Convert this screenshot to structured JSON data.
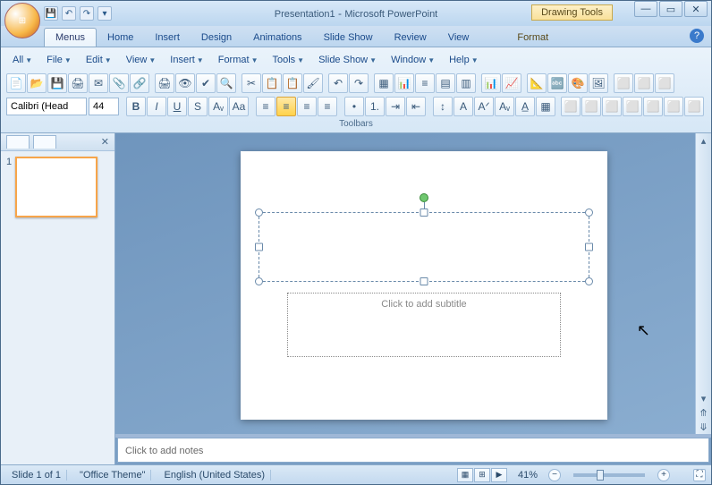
{
  "title": {
    "doc": "Presentation1",
    "app": "Microsoft PowerPoint",
    "contextual": "Drawing Tools"
  },
  "qat": [
    "💾",
    "↶",
    "↷"
  ],
  "tabs": [
    "Menus",
    "Home",
    "Insert",
    "Design",
    "Animations",
    "Slide Show",
    "Review",
    "View"
  ],
  "tabs_active": 0,
  "format_tab": "Format",
  "classic_menus": [
    "All",
    "File",
    "Edit",
    "View",
    "Insert",
    "Format",
    "Tools",
    "Slide Show",
    "Window",
    "Help"
  ],
  "ribbon_label": "Toolbars",
  "font": {
    "name": "Calibri (Head",
    "size": "44"
  },
  "thumb": {
    "num": "1"
  },
  "slide": {
    "subtitle_placeholder": "Click to add subtitle"
  },
  "notes_placeholder": "Click to add notes",
  "status": {
    "slide": "Slide 1 of 1",
    "theme": "\"Office Theme\"",
    "lang": "English (United States)",
    "zoom": "41%"
  },
  "iconrow1": [
    "📄",
    "📂",
    "💾",
    "🖨",
    "✉",
    "📎",
    "🔗",
    "|",
    "🖨",
    "👁",
    "✔",
    "🔍",
    "|",
    "✂",
    "📋",
    "📋",
    "🖌",
    "|",
    "↶",
    "↷",
    "|",
    "▦",
    "📊",
    "≡",
    "▤",
    "▥",
    "|",
    "📊",
    "📈",
    "|",
    "📐",
    "🔤",
    "🎨",
    "🖼",
    "|",
    "⬜",
    "⬜",
    "⬜"
  ],
  "iconrow2_buttons": [
    "B",
    "I",
    "U",
    "S",
    "Aᵥ",
    "Aa"
  ],
  "iconrow2_align": [
    "≡",
    "≡",
    "≡",
    "≡"
  ],
  "iconrow2_list": [
    "•",
    "1.",
    "⇥",
    "⇤"
  ],
  "iconrow2_extra": [
    "↕",
    "A",
    "Aᐟ",
    "Aᵥ",
    "A̲",
    "▦",
    "|",
    "⬜",
    "⬜",
    "⬜",
    "⬜",
    "⬜",
    "⬜",
    "⬜"
  ]
}
